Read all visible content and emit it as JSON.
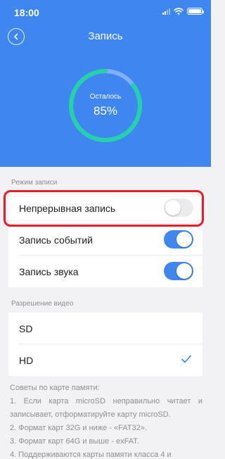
{
  "status_bar": {
    "time": "18:00"
  },
  "header": {
    "title": "Запись",
    "accent_color": "#3f86f0"
  },
  "storage": {
    "label": "Осталось",
    "value": "85%",
    "remaining_fraction": 0.85
  },
  "record_mode": {
    "section_label": "Режим записи",
    "items": [
      {
        "label": "Непрерывная запись",
        "enabled": false
      },
      {
        "label": "Запись событий",
        "enabled": true
      },
      {
        "label": "Запись звука",
        "enabled": true
      }
    ]
  },
  "video_resolution": {
    "section_label": "Разрешение видео",
    "options": [
      {
        "label": "SD",
        "selected": false
      },
      {
        "label": "HD",
        "selected": true
      }
    ]
  },
  "tips": {
    "heading": "Советы по карте памяти:",
    "lines": [
      "1. Если карта microSD неправильно читает и записывает, отформатируйте карту microSD.",
      "2. Формат карт 32G и ниже - «FAT32».",
      "3. Формат карт 64G и выше - exFAT.",
      "4. Поддерживаются карты памяти класса 4 и"
    ]
  },
  "highlight_color": "#e81c24"
}
